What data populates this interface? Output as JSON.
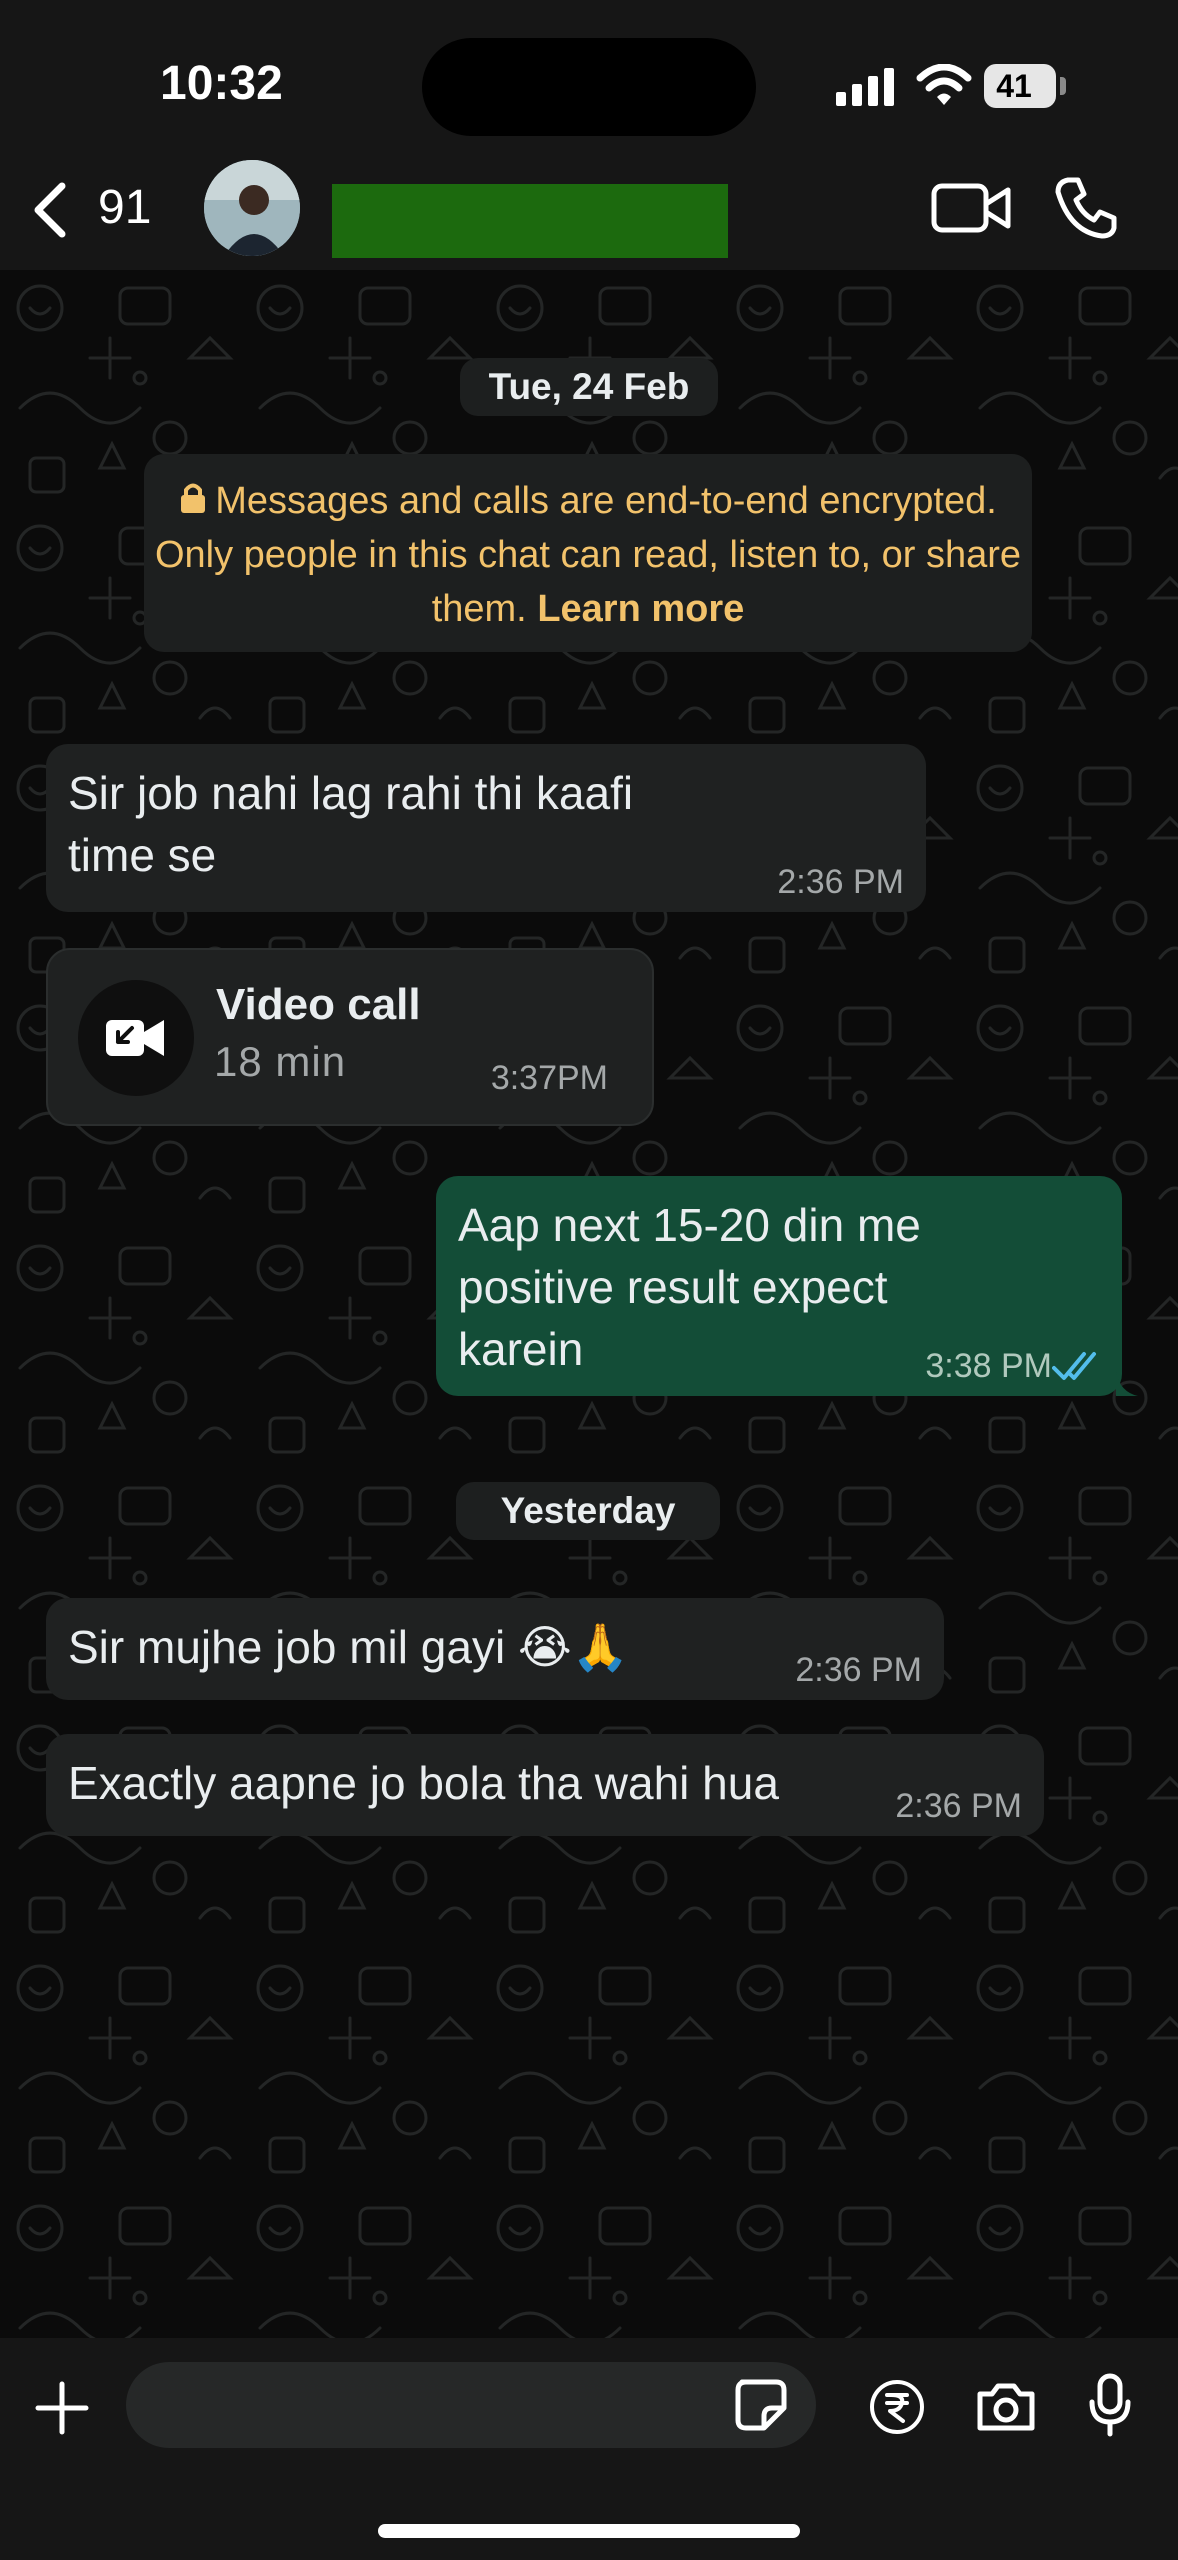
{
  "status_bar": {
    "time": "10:32",
    "battery": "41"
  },
  "header": {
    "back_count": "91",
    "contact_name_redacted": true,
    "accent_redaction_color": "#1c6a0e"
  },
  "messages": {
    "date_chip_1": "Tue, 24 Feb",
    "encryption_notice": "Messages and calls are end-to-end encrypted. Only people in this chat can read, listen to, or share them.",
    "encryption_link": "Learn more",
    "msg1": {
      "line1": "Sir job nahi lag rahi thi kaafi",
      "line2": "time se",
      "time": "2:36 PM"
    },
    "call": {
      "title": "Video call",
      "duration": "18 min",
      "time": "3:37PM"
    },
    "msg2": {
      "line1": "Aap next 15-20 din me",
      "line2": "positive result expect",
      "line3": "karein",
      "time": "3:38 PM"
    },
    "date_chip_2": "Yesterday",
    "msg3": {
      "text": "Sir mujhe job mil gayi 😭🙏",
      "time": "2:36 PM"
    },
    "msg4": {
      "text": "Exactly aapne jo bola tha wahi hua",
      "time": "2:36 PM"
    }
  },
  "input": {
    "placeholder": ""
  },
  "colors": {
    "incoming_bubble": "#1f2121",
    "outgoing_bubble": "#134d37",
    "notice_text": "#f2c26b",
    "read_ticks": "#53bdeb"
  },
  "icons": [
    "back-chevron-icon",
    "video-camera-icon",
    "phone-icon",
    "lock-icon",
    "incoming-video-call-icon",
    "double-check-icon",
    "plus-icon",
    "sticker-icon",
    "rupee-icon",
    "camera-icon",
    "microphone-icon"
  ]
}
